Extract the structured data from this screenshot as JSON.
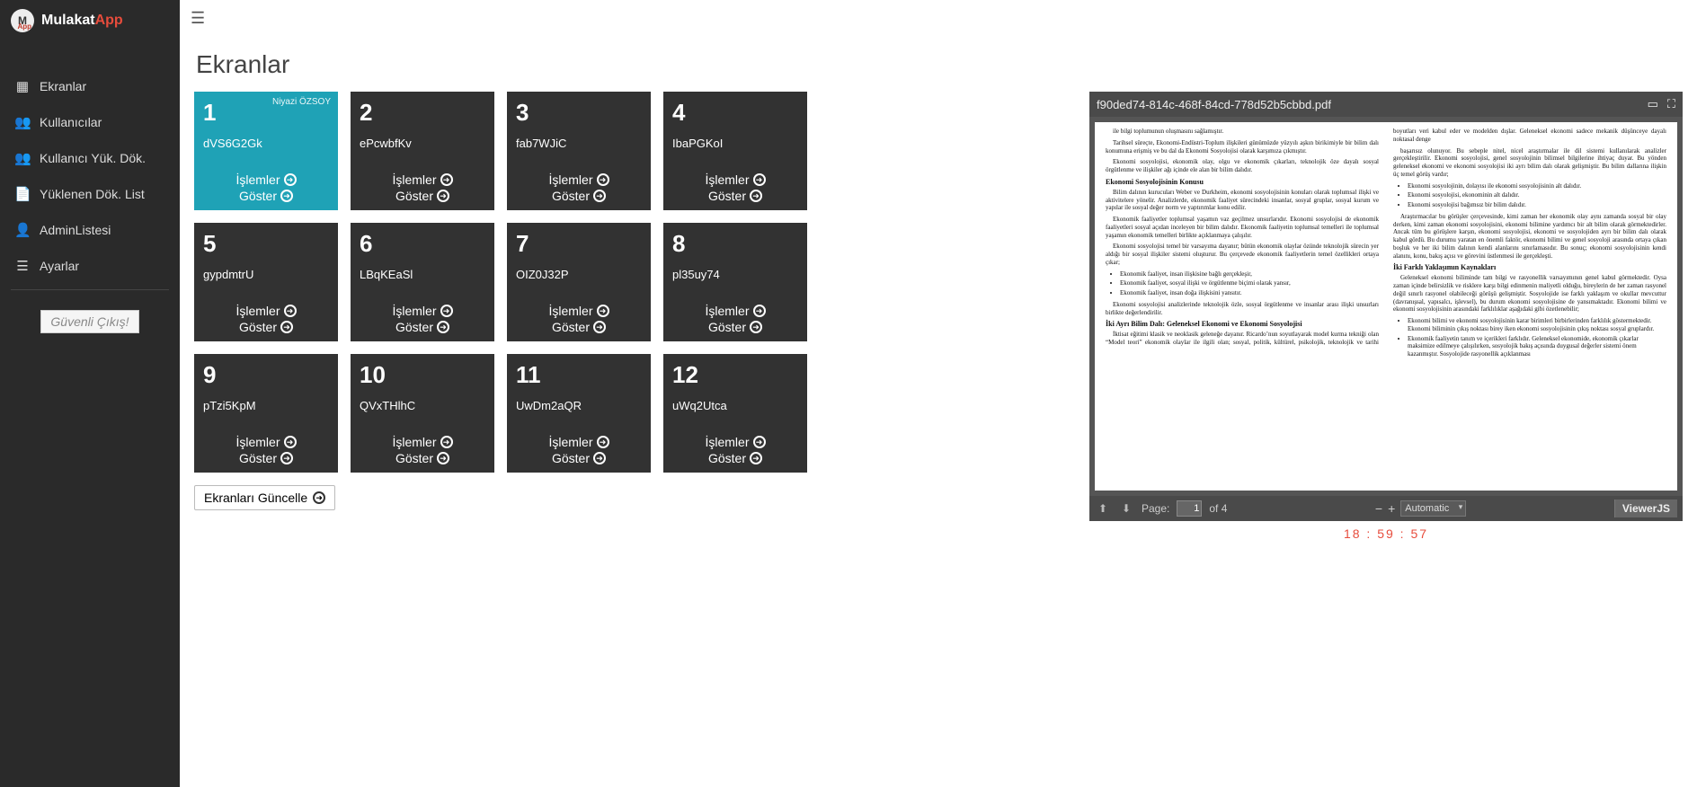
{
  "brand": {
    "name_a": "Mulakat",
    "name_b": "App",
    "logo_main": "M",
    "logo_sub": "App"
  },
  "sidebar": {
    "items": [
      {
        "icon": "grid-icon",
        "glyph": "▦",
        "label": "Ekranlar"
      },
      {
        "icon": "users-icon",
        "glyph": "👥",
        "label": "Kullanıcılar"
      },
      {
        "icon": "users-icon",
        "glyph": "👥",
        "label": "Kullanıcı Yük. Dök."
      },
      {
        "icon": "file-icon",
        "glyph": "📄",
        "label": "Yüklenen Dök. List"
      },
      {
        "icon": "user-icon",
        "glyph": "👤",
        "label": "AdminListesi"
      },
      {
        "icon": "list-icon",
        "glyph": "☰",
        "label": "Ayarlar"
      }
    ],
    "logout": "Güvenli Çıkış!"
  },
  "page": {
    "title": "Ekranlar"
  },
  "actions": {
    "islemler": "İşlemler",
    "goster": "Göster"
  },
  "cards": [
    {
      "num": "1",
      "code": "dVS6G2Gk",
      "owner": "Niyazi ÖZSOY",
      "active": true
    },
    {
      "num": "2",
      "code": "ePcwbfKv"
    },
    {
      "num": "3",
      "code": "fab7WJiC"
    },
    {
      "num": "4",
      "code": "IbaPGKoI"
    },
    {
      "num": "5",
      "code": "gypdmtrU"
    },
    {
      "num": "6",
      "code": "LBqKEaSl"
    },
    {
      "num": "7",
      "code": "OIZ0J32P"
    },
    {
      "num": "8",
      "code": "pl35uy74"
    },
    {
      "num": "9",
      "code": "pTzi5KpM"
    },
    {
      "num": "10",
      "code": "QVxTHlhC"
    },
    {
      "num": "11",
      "code": "UwDm2aQR"
    },
    {
      "num": "12",
      "code": "uWq2Utca"
    }
  ],
  "update_button": "Ekranları Güncelle",
  "viewer": {
    "filename": "f90ded74-814c-468f-84cd-778d52b5cbbd.pdf",
    "page_label": "Page:",
    "current_page": "1",
    "total_pages": "of 4",
    "zoom_mode": "Automatic",
    "brand": "ViewerJS",
    "timer": "18 : 59 : 57"
  },
  "pdf": {
    "p0": "ile bilgi toplumunun oluşmasını sağlamıştır.",
    "p1": "Tarihsel süreçte, Ekonomi-Endüstri-Toplum ilişkileri günümüzde yüzyılı aşkın birikimiyle bir bilim dalı konumuna erişmiş ve bu dal da Ekonomi Sosyolojisi olarak karşımıza çıkmıştır.",
    "p2": "Ekonomi sosyolojisi, ekonomik olay, olgu ve ekonomik çıkarları, teknolojik öze dayalı sosyal örgütlenme ve ilişkiler ağı içinde ele alan bir bilim dalıdır.",
    "h1": "Ekonomi Sosyolojisinin Konusu",
    "p3": "Bilim dalının kurucuları Weber ve Durkheim, ekonomi sosyolojisinin konuları olarak toplumsal ilişki ve aktivitelere yönelir. Analizlerde, ekonomik faaliyet sürecindeki insanlar, sosyal gruplar, sosyal kurum ve yapılar ile sosyal değer norm ve yaptırımlar konu edilir.",
    "p4": "Ekonomik faaliyetler toplumsal yaşamın vaz geçilmez unsurlarıdır. Ekonomi sosyolojisi de ekonomik faaliyetleri sosyal açıdan inceleyen bir bilim dalıdır. Ekonomik faaliyetin toplumsal temelleri ile toplumsal yaşamın ekonomik temelleri birlikte açıklanmaya çalışılır.",
    "p5": "Ekonomi sosyolojisi temel bir varsayıma dayanır; bütün ekonomik olaylar özünde teknolojik sürecin yer aldığı bir sosyal ilişkiler sistemi oluşturur. Bu çerçevede ekonomik faaliyetlerin temel özellikleri ortaya çıkar;",
    "b1": "Ekonomik faaliyet, insan ilişkisine bağlı gerçekleşir,",
    "b2": "Ekonomik faaliyet, sosyal ilişki ve örgütlenme biçimi olarak yansır,",
    "b3": "Ekonomik faaliyet, insan doğa ilişkisini yansıtır.",
    "p6": "Ekonomi sosyolojisi analizlerinde teknolojik özle, sosyal örgütlenme ve insanlar arası ilişki unsurları birlikte değerlendirilir.",
    "h2": "İki Ayrı Bilim Dalı: Geleneksel Ekonomi ve Ekonomi Sosyolojisi",
    "p7": "İktisat eğitimi klasik ve neoklasik geleneğe dayanır. Ricardo’nun soyutlayarak model kurma tekniği olan “Model teori” ekonomik olaylar ile ilgili olan; sosyal, politik, kültürel, psikolojik, teknolojik ve tarihi boyutları veri kabul eder ve modelden dışlar. Geleneksel ekonomi sadece mekanik düşünceye dayalı noktasal denge",
    "p8": "başarısız olunuyor. Bu sebeple nitel, nicel araştırmalar ile dil sistemi kullanılarak analizler gerçekleştirilir. Ekonomi sosyolojisi, genel sosyolojinin bilimsel bilgilerine ihtiyaç duyar. Bu yönden geleneksel ekonomi ve ekonomi sosyolojisi iki ayrı bilim dalı olarak gelişmiştir. Bu bilim dallarına ilişkin üç temel görüş vardır;",
    "c1": "Ekonomi sosyolojinin, dolayısı ile ekonomi sosyolojisinin alt dalıdır.",
    "c2": "Ekonomi sosyolojisi, ekonominin alt dalıdır.",
    "c3": "Ekonomi sosyolojisi bağımsız bir bilim dalıdır.",
    "p9": "Araştırmacılar bu görüşler çerçevesinde, kimi zaman her ekonomik olay aynı zamanda sosyal bir olay derken, kimi zaman ekonomi sosyolojisini, ekonomi bilimine yardımcı bir alt bilim olarak görmektedirler. Ancak tüm bu görüşlere karşın, ekonomi sosyolojisi, ekonomi ve sosyolojiden ayrı bir bilim dalı olarak kabul gördü. Bu durumu yaratan en önemli faktör, ekonomi bilimi ve genel sosyoloji arasında ortaya çıkan boşluk ve her iki bilim dalının kendi alanlarını sınırlamasıdır. Bu sonuç; ekonomi sosyolojisinin kendi alanını, konu, bakış açısı ve görevini üstlenmesi ile gerçekleşti.",
    "h3": "İki Farklı Yaklaşımın Kaynakları",
    "p10": "Geleneksel ekonomi biliminde tam bilgi ve rasyonellik varsayımının genel kabul görmektedir. Oysa zaman içinde belirsizlik ve risklere karşı bilgi edinmenin maliyetli olduğu, bireylerin de her zaman rasyonel değil sınırlı rasyonel olabileceği görüşü gelişmiştir. Sosyolojide ise farklı yaklaşım ve okullar mevcuttur (davranışsal, yapısalcı, işlevsel), bu durum ekonomi sosyolojisine de yansımaktadır. Ekonomi bilimi ve ekonomi sosyolojisinin arasındaki farklılıklar aşağıdaki gibi özetlenebilir;",
    "d1": "Ekonomi bilimi ve ekonomi sosyolojisinin karar birimleri birbirlerinden farklılık göstermektedir. Ekonomi biliminin çıkış noktası birey iken ekonomi sosyolojisinin çıkış noktası sosyal gruplardır.",
    "d2": "Ekonomik faaliyetin tanım ve içerikleri farklıdır. Geleneksel ekonomide, ekonomik çıkarlar maksimize edilmeye çalışılırken, sosyolojik bakış açısında duygusal değerler sistemi önem kazanmıştır. Sosyolojide rasyonellik açıklanması"
  }
}
